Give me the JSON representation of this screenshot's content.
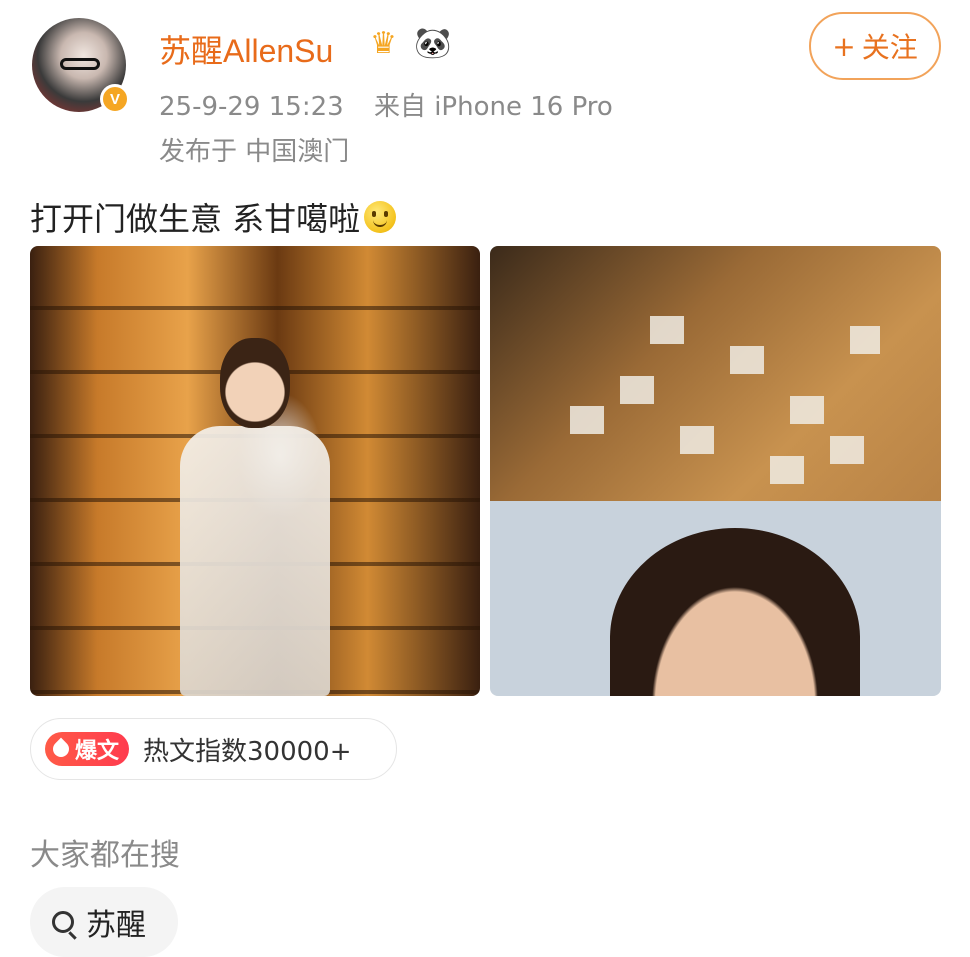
{
  "post": {
    "author": {
      "name": "苏醒AllenSu",
      "verified_mark": "V",
      "badges": {
        "crown_icon": "♛",
        "panda_icon": "🐼"
      }
    },
    "follow_label": "关注",
    "follow_plus": "+",
    "time": "25-9-29 15:23",
    "source": "来自 iPhone 16 Pro",
    "location": "发布于 中国澳门",
    "text": "打开门做生意 系甘噶啦",
    "images": [
      {
        "name": "bar-counter-photo"
      },
      {
        "name": "polaroid-wall-selfie-photo"
      }
    ],
    "hot": {
      "tag": "爆文",
      "text": "热文指数30000+"
    }
  },
  "trending": {
    "title": "大家都在搜",
    "items": [
      {
        "label": "苏醒"
      }
    ]
  },
  "colors": {
    "username": "#e86b1a",
    "follow_border": "#f2a35a",
    "hot_tag": "#ff3b4e",
    "meta_text": "#8a8a8a"
  }
}
